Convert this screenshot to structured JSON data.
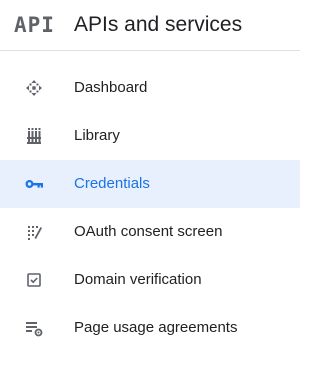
{
  "header": {
    "logo_text": "API",
    "title": "APIs and services"
  },
  "nav": {
    "items": [
      {
        "label": "Dashboard",
        "icon": "dashboard-icon",
        "active": false
      },
      {
        "label": "Library",
        "icon": "library-icon",
        "active": false
      },
      {
        "label": "Credentials",
        "icon": "key-icon",
        "active": true
      },
      {
        "label": "OAuth consent screen",
        "icon": "consent-icon",
        "active": false
      },
      {
        "label": "Domain verification",
        "icon": "checkbox-icon",
        "active": false
      },
      {
        "label": "Page usage agreements",
        "icon": "settings-list-icon",
        "active": false
      }
    ]
  },
  "colors": {
    "active_bg": "#e8f0fe",
    "active_text": "#1a73e8",
    "icon": "#5f6368",
    "text": "#202124"
  }
}
